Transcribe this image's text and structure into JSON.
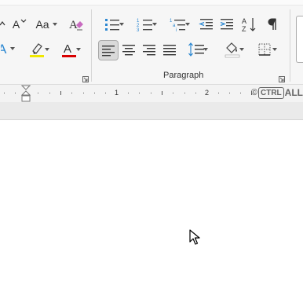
{
  "ribbon": {
    "font_group": {
      "change_case_label": "Aa",
      "grow_font_label": "A"
    },
    "paragraph_group": {
      "label": "Paragraph"
    },
    "colors": {
      "highlight": "#f0e800",
      "font_color": "#d80000"
    }
  },
  "ruler": {
    "numbers": [
      "1",
      "2"
    ]
  },
  "watermark": {
    "symbol": "©",
    "box_text": "CTRL",
    "trailing_text": "ALL"
  }
}
